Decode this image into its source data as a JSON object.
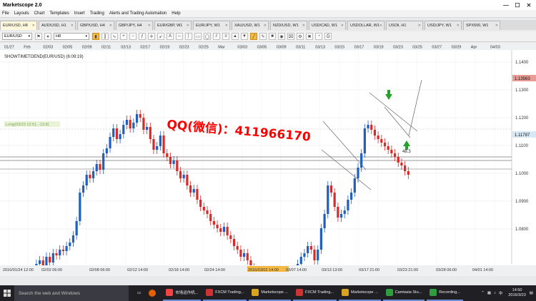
{
  "app": {
    "title": "Marketscope 2.0"
  },
  "window_controls": {
    "minimize": "—",
    "maximize": "☐",
    "close": "✕"
  },
  "menu": [
    "File",
    "Layouts",
    "Chart",
    "Templates",
    "Insert",
    "Trading",
    "Alerts and Trading Automation",
    "Help"
  ],
  "tabs": [
    "EUR/USD, H8",
    "AUD/USD, H1",
    "GBP/USD, H4",
    "GBP/JPY, H4",
    "EUR/GBP, W1",
    "EUR/JPY, W1",
    "XAU/USD, W1",
    "NZD/USD, W1",
    "USD/CAD, W1",
    "USDOLLAR, W1",
    "USOil, H1",
    "USD/JPY, W1",
    "SPX500, W1"
  ],
  "toolbar": {
    "symbol": "EUR/USD",
    "timeframe": "H8"
  },
  "chart": {
    "indicator_label": "SHOWTIMETOEND(EUR/USD) (6:09:19)",
    "line_label": "Long(03/23 12:51, -13.8)",
    "watermark": "QQ(微信)：411966170",
    "annotation": "48.3",
    "price_top": "1.13563",
    "price_current": "1.11787",
    "top_dates": [
      "01/27",
      "Feb",
      "02/03",
      "02/05",
      "02/09",
      "02/11",
      "02/13",
      "02/17",
      "02/19",
      "02/23",
      "02/25",
      "Mar",
      "03/03",
      "03/05",
      "03/09",
      "03/11",
      "03/13",
      "03/15",
      "03/17",
      "03/19",
      "03/23",
      "03/25",
      "03/27",
      "03/29",
      "Apr",
      "04/03"
    ],
    "price_ticks": [
      "1.1400",
      "1.1300",
      "1.1200",
      "1.1100",
      "1.1000",
      "1.0900",
      "1.0800"
    ],
    "bottom_dates": [
      "2016/01/24 12:00",
      "02/02 06:00",
      "02/08 06:00",
      "02/12 14:00",
      "02/18 14:00",
      "02/24 14:00",
      "2016/03/02 14:00",
      "03/07 14:00",
      "03/13 13:00",
      "03/17 21:00",
      "03/23 21:00",
      "03/28 06:00",
      "04/01 14:00"
    ]
  },
  "taskbar": {
    "search_placeholder": "Search the web and Windows",
    "items": [
      "市场运作机...",
      "FXCM Trading...",
      "Marketscope ...",
      "FXCM Trading...",
      "Marketscope ...",
      "Camtasia Stu...",
      "Recording..."
    ],
    "time": "14:50",
    "date": "2016/3/23"
  }
}
